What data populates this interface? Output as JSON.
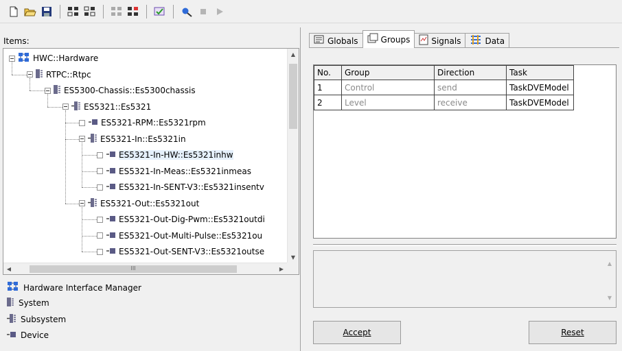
{
  "toolbar": {
    "buttons": [
      "new-file-icon",
      "open-folder-icon",
      "save-icon",
      "add-module-icon",
      "remove-module-icon",
      "disabled-module-icon",
      "connect-module-icon",
      "check-icon",
      "search-icon",
      "stop-icon",
      "play-icon"
    ]
  },
  "left": {
    "items_label": "Items:",
    "tree": [
      {
        "label": "HWC::Hardware",
        "level": 0,
        "kind": "hwm",
        "toggle": "expanded"
      },
      {
        "label": "RTPC::Rtpc",
        "level": 1,
        "kind": "system",
        "toggle": "expanded"
      },
      {
        "label": "ES5300-Chassis::Es5300chassis",
        "level": 2,
        "kind": "system",
        "toggle": "expanded"
      },
      {
        "label": "ES5321::Es5321",
        "level": 3,
        "kind": "subsystem",
        "toggle": "expanded"
      },
      {
        "label": "ES5321-RPM::Es5321rpm",
        "level": 4,
        "kind": "device",
        "toggle": "check"
      },
      {
        "label": "ES5321-In::Es5321in",
        "level": 4,
        "kind": "subsystem",
        "toggle": "expanded"
      },
      {
        "label": "ES5321-In-HW::Es5321inhw",
        "level": 5,
        "kind": "device",
        "toggle": "check",
        "selected": true
      },
      {
        "label": "ES5321-In-Meas::Es5321inmeas",
        "level": 5,
        "kind": "device",
        "toggle": "check"
      },
      {
        "label": "ES5321-In-SENT-V3::Es5321insentv",
        "level": 5,
        "kind": "device",
        "toggle": "check"
      },
      {
        "label": "ES5321-Out::Es5321out",
        "level": 4,
        "kind": "subsystem",
        "toggle": "expanded"
      },
      {
        "label": "ES5321-Out-Dig-Pwm::Es5321outdi",
        "level": 5,
        "kind": "device",
        "toggle": "check"
      },
      {
        "label": "ES5321-Out-Multi-Pulse::Es5321ou",
        "level": 5,
        "kind": "device",
        "toggle": "check"
      },
      {
        "label": "ES5321-Out-SENT-V3::Es5321outse",
        "level": 5,
        "kind": "device",
        "toggle": "check"
      }
    ],
    "scroll_thumb_text": "III",
    "legend": [
      {
        "label": "Hardware Interface Manager",
        "kind": "hwm"
      },
      {
        "label": "System",
        "kind": "system"
      },
      {
        "label": "Subsystem",
        "kind": "subsystem"
      },
      {
        "label": "Device",
        "kind": "device"
      }
    ]
  },
  "right": {
    "tabs": [
      {
        "label": "Globals",
        "icon": "globals-icon",
        "active": false
      },
      {
        "label": "Groups",
        "icon": "groups-icon",
        "active": true
      },
      {
        "label": "Signals",
        "icon": "signals-icon",
        "active": false
      },
      {
        "label": "Data",
        "icon": "data-icon",
        "active": false
      }
    ],
    "table": {
      "headers": [
        "No.",
        "Group",
        "Direction",
        "Task"
      ],
      "rows": [
        [
          "1",
          "Control",
          "send",
          "TaskDVEModel"
        ],
        [
          "2",
          "Level",
          "receive",
          "TaskDVEModel"
        ]
      ]
    },
    "accept_label": "Accept",
    "reset_label": "Reset"
  }
}
